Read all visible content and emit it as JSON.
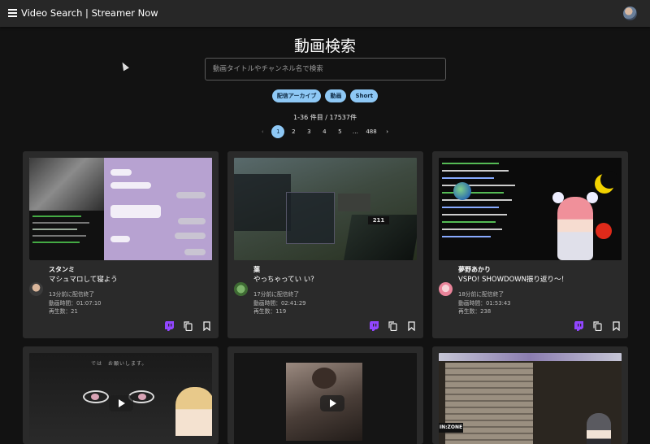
{
  "app": {
    "title": "Video Search | Streamer Now"
  },
  "page": {
    "title": "動画検索"
  },
  "search": {
    "placeholder": "動画タイトルやチャンネル名で検索",
    "value": ""
  },
  "filters": [
    {
      "label": "配信アーカイブ"
    },
    {
      "label": "動画"
    },
    {
      "label": "Short"
    }
  ],
  "results": {
    "count_text": "1-36 件目 / 17537件"
  },
  "pagination": {
    "prev": "‹",
    "pages": [
      "1",
      "2",
      "3",
      "4",
      "5",
      "…",
      "488"
    ],
    "next": "›",
    "current": "1"
  },
  "videos": [
    {
      "channel": "スタンミ",
      "title": "マシュマロして寝よう",
      "ended": "13分前に配信終了",
      "duration": "動画時間：01:07:10",
      "views": "再生数：21",
      "platform": "twitch-icon"
    },
    {
      "channel": "葉",
      "title": "やっちゃってい い？",
      "ended": "17分前に配信終了",
      "duration": "動画時間：02:41:29",
      "views": "再生数：119",
      "platform": "twitch-icon"
    },
    {
      "channel": "夢野あかり",
      "title": "VSPO! SHOWDOWN振り返り〜！",
      "ended": "18分前に配信終了",
      "duration": "動画時間：01:53:43",
      "views": "再生数：238",
      "platform": "twitch-icon"
    },
    {
      "thumb_text": "では　お願いします。"
    },
    {},
    {}
  ],
  "colors": {
    "accent": "#8ec8f5",
    "card": "#2a2a2a",
    "background": "#121212",
    "twitch": "#9146ff"
  }
}
